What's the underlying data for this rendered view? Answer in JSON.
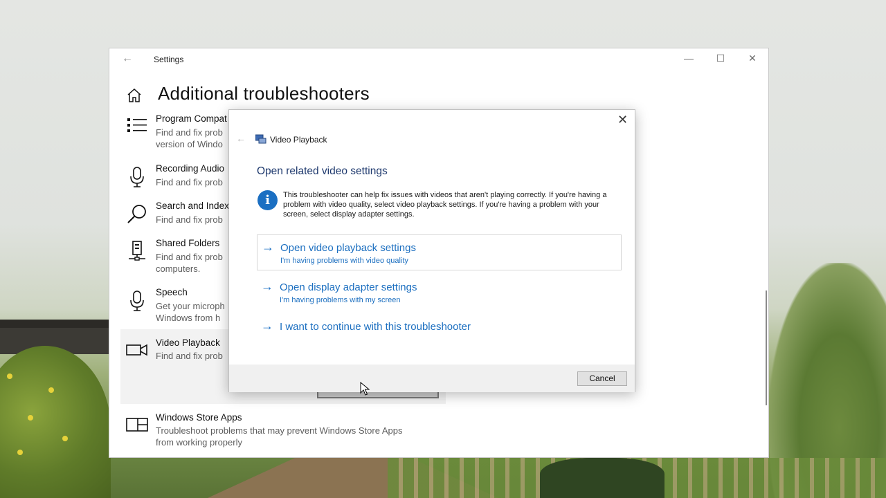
{
  "window": {
    "title": "Settings",
    "back_glyph": "←",
    "minimize_glyph": "—",
    "maximize_glyph": "☐",
    "close_glyph": "✕"
  },
  "page": {
    "title": "Additional troubleshooters",
    "home_icon": "home-icon"
  },
  "troubleshooters": [
    {
      "name": "Program Compat",
      "description": "Find and fix prob\nversion of Windo",
      "icon": "list-icon"
    },
    {
      "name": "Recording Audio",
      "description": "Find and fix prob",
      "icon": "microphone-icon"
    },
    {
      "name": "Search and Index",
      "description": "Find and fix prob",
      "icon": "search-icon"
    },
    {
      "name": "Shared Folders",
      "description": "Find and fix prob\ncomputers.",
      "icon": "shared-folders-icon"
    },
    {
      "name": "Speech",
      "description": "Get your microph\nWindows from h",
      "icon": "microphone-icon"
    },
    {
      "name": "Video Playback",
      "description": "Find and fix prob",
      "icon": "video-camera-icon",
      "selected": true
    },
    {
      "name": "Windows Store Apps",
      "description": "Troubleshoot problems that may prevent Windows Store Apps\nfrom working properly",
      "icon": "store-apps-icon"
    }
  ],
  "dialog": {
    "close_glyph": "✕",
    "back_glyph": "←",
    "app_title": "Video Playback",
    "heading": "Open related video settings",
    "info_text": "This troubleshooter can help fix issues with videos that aren't playing correctly. If you're having a problem with video quality, select video playback settings. If you're having a problem with your screen, select display adapter settings.",
    "options": [
      {
        "title": "Open video playback settings",
        "subtitle": "I'm having problems with video quality"
      },
      {
        "title": "Open display adapter settings",
        "subtitle": "I'm having problems with my screen"
      },
      {
        "title": "I want to continue with this troubleshooter",
        "subtitle": ""
      }
    ],
    "arrow_glyph": "→",
    "cancel_label": "Cancel"
  },
  "colors": {
    "accent": "#1c6fc0",
    "heading": "#1f3a6e",
    "info_icon": "#1b6fc2"
  }
}
